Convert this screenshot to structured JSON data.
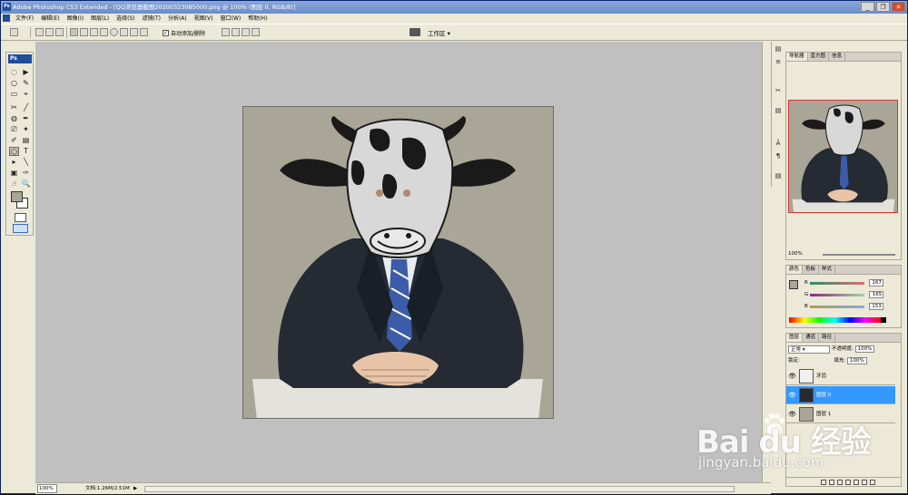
{
  "app": {
    "title": "Adobe Photoshop CS3 Extended - [QQ浏览器截图20200323085000.png @ 100% (图层 0, RGB/8)]",
    "ps_logo": "Ps"
  },
  "window_controls": {
    "minimize": "_",
    "restore": "❐",
    "close": "✕"
  },
  "menu": [
    "文件(F)",
    "编辑(E)",
    "图像(I)",
    "图层(L)",
    "选择(S)",
    "滤镜(T)",
    "分析(A)",
    "视图(V)",
    "窗口(W)",
    "帮助(H)"
  ],
  "options_bar": {
    "auto_add_delete": "自动添加/删除",
    "checkbox_checked": "✓",
    "workspace": "工作区 ▾"
  },
  "toolbox": {
    "badge": "Ps",
    "tools": [
      "◌",
      "▶",
      "○",
      "✎",
      "▭",
      "⌖",
      "✂",
      "╱",
      "◍",
      "✒",
      "⎚",
      "✦",
      "✐",
      "▤",
      "⬡",
      "◐",
      "✋",
      "T",
      "▸",
      "╲",
      "▣",
      "✑",
      "☝",
      "🔍"
    ]
  },
  "canvas": {
    "background": "#a9a697"
  },
  "status": {
    "zoom": "100%",
    "doc": "文档:1.26M/2.51M",
    "arrow": "▶"
  },
  "navigator": {
    "tabs": [
      "导航器",
      "直方图",
      "信息"
    ],
    "zoom": "100%"
  },
  "color_panel": {
    "tabs": [
      "颜色",
      "色板",
      "样式"
    ],
    "rows": [
      {
        "label": "R",
        "value": "167",
        "color": "#e07070"
      },
      {
        "label": "G",
        "value": "165",
        "color": "#8a5aa8"
      },
      {
        "label": "B",
        "value": "153",
        "color": "#6a8ad0"
      }
    ],
    "fg_color": "#a9a697"
  },
  "layers_panel": {
    "tabs": [
      "图层",
      "通道",
      "路径"
    ],
    "mode": "正常 ▾",
    "opacity_label": "不透明度:",
    "opacity": "100%",
    "lock_label": "锁定:",
    "fill_label": "填充:",
    "fill": "100%",
    "layers": [
      {
        "name": "牙齿",
        "selected": false
      },
      {
        "name": "图层 0",
        "selected": true
      },
      {
        "name": "图层 1",
        "selected": false
      }
    ],
    "eye": "👁"
  },
  "dock_icons": [
    "▤",
    "≡",
    "✂",
    "▤",
    "Â",
    "¶",
    "▤"
  ],
  "watermark": {
    "brand": "Bai du 经验",
    "url": "jingyan.baidu.com"
  }
}
